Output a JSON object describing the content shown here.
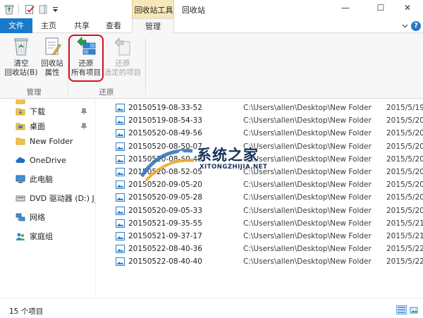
{
  "title_bar": {
    "contextual_tool_group": "回收站工具",
    "window_title": "回收站",
    "minimize_symbol": "—",
    "maximize_symbol": "☐",
    "close_symbol": "✕"
  },
  "tabs": [
    {
      "label": "文件",
      "kind": "file"
    },
    {
      "label": "主页"
    },
    {
      "label": "共享"
    },
    {
      "label": "查看"
    },
    {
      "label": "管理",
      "active": true
    }
  ],
  "ribbon": {
    "buttons": [
      {
        "line1": "清空",
        "line2": "回收站(B)",
        "icon": "empty-recycle-bin-icon",
        "enabled": true
      },
      {
        "line1": "回收站",
        "line2": "属性",
        "icon": "recycle-bin-properties-icon",
        "enabled": true
      },
      {
        "line1": "还原",
        "line2": "所有项目",
        "icon": "restore-all-icon",
        "enabled": true,
        "highlighted": true
      },
      {
        "line1": "还原",
        "line2": "选定的项目",
        "icon": "restore-selected-icon",
        "enabled": false
      }
    ],
    "groups": [
      "管理",
      "还原"
    ],
    "highlight_color": "#d3121b"
  },
  "navigation": {
    "items": [
      {
        "label": "下载",
        "icon": "downloads-icon",
        "pinned": true
      },
      {
        "label": "桌面",
        "icon": "desktop-folder-icon",
        "pinned": true
      },
      {
        "label": "New Folder",
        "icon": "folder-icon",
        "pinned": false
      },
      {
        "label": "OneDrive",
        "icon": "onedrive-icon"
      },
      {
        "label": "此电脑",
        "icon": "this-pc-icon"
      },
      {
        "label": "DVD 驱动器 (D:) J_C",
        "icon": "dvd-drive-icon"
      },
      {
        "label": "网络",
        "icon": "network-icon"
      },
      {
        "label": "家庭组",
        "icon": "homegroup-icon"
      }
    ]
  },
  "files": [
    {
      "name": "20150519-08-33-52",
      "path": "C:\\Users\\allen\\Desktop\\New Folder",
      "date": "2015/5/19"
    },
    {
      "name": "20150519-08-54-33",
      "path": "C:\\Users\\allen\\Desktop\\New Folder",
      "date": "2015/5/20"
    },
    {
      "name": "20150520-08-49-56",
      "path": "C:\\Users\\allen\\Desktop\\New Folder",
      "date": "2015/5/20"
    },
    {
      "name": "20150520-08-50-07",
      "path": "C:\\Users\\allen\\Desktop\\New Folder",
      "date": "2015/5/20"
    },
    {
      "name": "20150520-08-50-49",
      "path": "C:\\Users\\allen\\Desktop\\New Folder",
      "date": "2015/5/20"
    },
    {
      "name": "20150520-08-52-05",
      "path": "C:\\Users\\allen\\Desktop\\New Folder",
      "date": "2015/5/20"
    },
    {
      "name": "20150520-09-05-20",
      "path": "C:\\Users\\allen\\Desktop\\New Folder",
      "date": "2015/5/20"
    },
    {
      "name": "20150520-09-05-28",
      "path": "C:\\Users\\allen\\Desktop\\New Folder",
      "date": "2015/5/20"
    },
    {
      "name": "20150520-09-05-33",
      "path": "C:\\Users\\allen\\Desktop\\New Folder",
      "date": "2015/5/20"
    },
    {
      "name": "20150521-09-35-55",
      "path": "C:\\Users\\allen\\Desktop\\New Folder",
      "date": "2015/5/21"
    },
    {
      "name": "20150521-09-37-17",
      "path": "C:\\Users\\allen\\Desktop\\New Folder",
      "date": "2015/5/21"
    },
    {
      "name": "20150522-08-40-36",
      "path": "C:\\Users\\allen\\Desktop\\New Folder",
      "date": "2015/5/22"
    },
    {
      "name": "20150522-08-40-40",
      "path": "C:\\Users\\allen\\Desktop\\New Folder",
      "date": "2015/5/22"
    }
  ],
  "status_bar": {
    "item_count": "15 个项目"
  },
  "watermark": {
    "title": "系统之家",
    "subtitle": "XITONGZHIJIA.NET"
  },
  "colors": {
    "file_tab": "#1979ca",
    "contextual_tab": "#f6e7b8",
    "ribbon_background": "#f7f7f7"
  }
}
